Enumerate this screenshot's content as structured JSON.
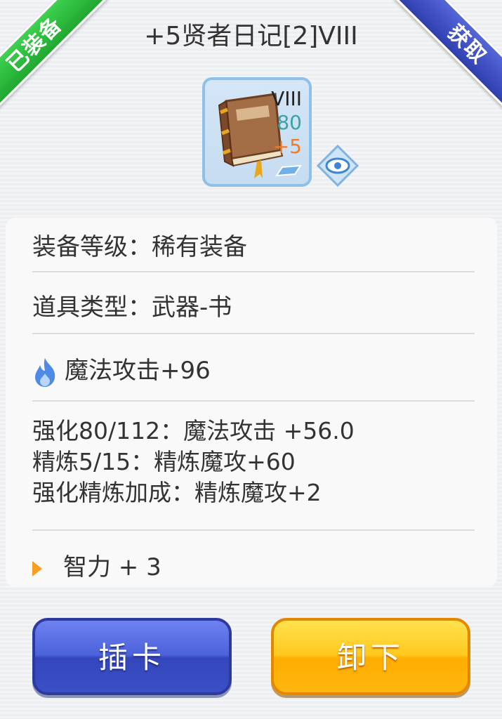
{
  "header": {
    "equipped_badge": "已装备",
    "obtain_badge": "获取",
    "title": "+5贤者日记[2]VIII"
  },
  "item_icon": {
    "rank": "VIII",
    "level": "80",
    "refine": "+5",
    "preview_icon": "eye-icon"
  },
  "details": {
    "grade": "装备等级：稀有装备",
    "type": "道具类型：武器-书",
    "base_stat": "魔法攻击+96",
    "enhance": "强化80/112：魔法攻击 +56.0",
    "refine": "精炼5/15：精炼魔攻+60",
    "bonus": "强化精炼加成：精炼魔攻+2",
    "extra": "智力 + 3"
  },
  "buttons": {
    "insert_card": "插卡",
    "unequip": "卸下"
  },
  "colors": {
    "equipped_green": "#2dbd3e",
    "obtain_blue": "#3f50c4",
    "button_blue": "#4c62da",
    "button_orange": "#ffb60f",
    "level_teal": "#3aa3a8",
    "refine_orange": "#f07a28"
  }
}
